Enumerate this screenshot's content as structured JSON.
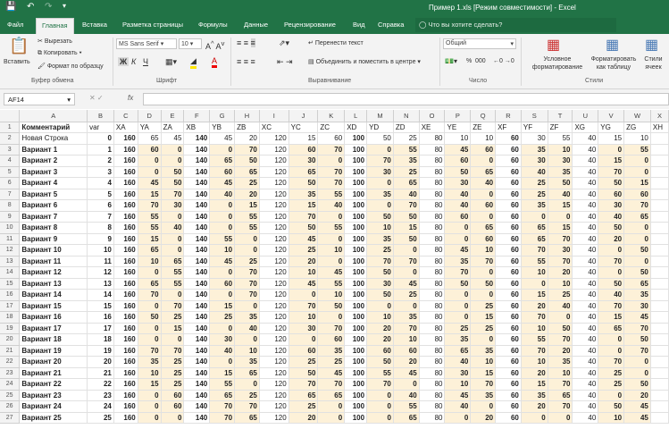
{
  "window": {
    "title": "Пример 1.xls [Режим совместимости] - Excel"
  },
  "tabs": [
    "Файл",
    "Главная",
    "Вставка",
    "Разметка страницы",
    "Формулы",
    "Данные",
    "Рецензирование",
    "Вид",
    "Справка"
  ],
  "search_placeholder": "Что вы хотите сделать?",
  "ribbon": {
    "paste": "Вставить",
    "cut": "Вырезать",
    "copy": "Копировать",
    "format_painter": "Формат по образцу",
    "clipboard_group": "Буфер обмена",
    "font_name": "MS Sans Serif",
    "font_size": "10",
    "bold": "Ж",
    "italic": "К",
    "underline": "Ч",
    "font_group": "Шрифт",
    "wrap_text": "Перенести текст",
    "merge_center": "Объединить и поместить в центре",
    "alignment_group": "Выравнивание",
    "number_format": "Общий",
    "percent": "%",
    "thousands": "000",
    "number_group": "Число",
    "cond_format": "Условное форматирование",
    "format_table": "Форматировать как таблицу",
    "cell_styles": "Стили ячеек",
    "styles_group": "Стили"
  },
  "formula_bar": {
    "name_box": "AF14",
    "fx": "fx",
    "value": ""
  },
  "grid": {
    "columns": [
      "A",
      "B",
      "C",
      "D",
      "E",
      "F",
      "G",
      "H",
      "I",
      "J",
      "K",
      "L",
      "M",
      "N",
      "O",
      "P",
      "Q",
      "R",
      "S",
      "T",
      "U",
      "V",
      "W",
      "X"
    ],
    "header_row": [
      "Комментарий",
      "var",
      "XA",
      "YA",
      "ZA",
      "XB",
      "YB",
      "ZB",
      "XC",
      "YC",
      "ZC",
      "XD",
      "YD",
      "ZD",
      "XE",
      "YE",
      "ZE",
      "XF",
      "YF",
      "ZF",
      "XG",
      "YG",
      "ZG",
      "XH"
    ],
    "rows": [
      [
        "Новая Строка",
        0,
        160,
        65,
        45,
        140,
        45,
        20,
        120,
        15,
        60,
        100,
        50,
        25,
        80,
        10,
        10,
        60,
        30,
        55,
        40,
        15,
        10
      ],
      [
        "Вариант 1",
        1,
        160,
        60,
        0,
        140,
        0,
        70,
        120,
        60,
        70,
        100,
        0,
        55,
        80,
        45,
        60,
        60,
        35,
        10,
        40,
        0,
        55
      ],
      [
        "Вариант 2",
        2,
        160,
        0,
        0,
        140,
        65,
        50,
        120,
        30,
        0,
        100,
        70,
        35,
        80,
        60,
        0,
        60,
        30,
        30,
        40,
        15,
        0
      ],
      [
        "Вариант 3",
        3,
        160,
        0,
        50,
        140,
        60,
        65,
        120,
        65,
        70,
        100,
        30,
        25,
        80,
        50,
        65,
        60,
        40,
        35,
        40,
        70,
        0
      ],
      [
        "Вариант 4",
        4,
        160,
        45,
        50,
        140,
        45,
        25,
        120,
        50,
        70,
        100,
        0,
        65,
        80,
        30,
        40,
        60,
        25,
        50,
        40,
        50,
        15
      ],
      [
        "Вариант 5",
        5,
        160,
        15,
        70,
        140,
        40,
        20,
        120,
        35,
        55,
        100,
        35,
        40,
        80,
        40,
        0,
        60,
        25,
        40,
        40,
        60,
        60
      ],
      [
        "Вариант 6",
        6,
        160,
        70,
        30,
        140,
        0,
        15,
        120,
        15,
        40,
        100,
        0,
        70,
        80,
        40,
        60,
        60,
        35,
        15,
        40,
        30,
        70
      ],
      [
        "Вариант 7",
        7,
        160,
        55,
        0,
        140,
        0,
        55,
        120,
        70,
        0,
        100,
        50,
        50,
        80,
        60,
        0,
        60,
        0,
        0,
        40,
        40,
        65
      ],
      [
        "Вариант 8",
        8,
        160,
        55,
        40,
        140,
        0,
        55,
        120,
        50,
        55,
        100,
        10,
        15,
        80,
        0,
        65,
        60,
        65,
        15,
        40,
        50,
        0
      ],
      [
        "Вариант 9",
        9,
        160,
        15,
        0,
        140,
        55,
        0,
        120,
        45,
        0,
        100,
        35,
        50,
        80,
        0,
        60,
        60,
        65,
        70,
        40,
        20,
        0
      ],
      [
        "Вариант 10",
        10,
        160,
        65,
        0,
        140,
        10,
        0,
        120,
        25,
        10,
        100,
        25,
        0,
        80,
        45,
        10,
        60,
        70,
        30,
        40,
        0,
        50
      ],
      [
        "Вариант 11",
        11,
        160,
        10,
        65,
        140,
        45,
        25,
        120,
        20,
        0,
        100,
        70,
        70,
        80,
        35,
        70,
        60,
        55,
        70,
        40,
        70,
        0
      ],
      [
        "Вариант 12",
        12,
        160,
        0,
        55,
        140,
        0,
        70,
        120,
        10,
        45,
        100,
        50,
        0,
        80,
        70,
        0,
        60,
        10,
        20,
        40,
        0,
        50
      ],
      [
        "Вариант 13",
        13,
        160,
        65,
        55,
        140,
        60,
        70,
        120,
        45,
        55,
        100,
        30,
        45,
        80,
        50,
        50,
        60,
        0,
        10,
        40,
        50,
        65
      ],
      [
        "Вариант 14",
        14,
        160,
        70,
        0,
        140,
        0,
        70,
        120,
        0,
        10,
        100,
        50,
        25,
        80,
        0,
        0,
        60,
        15,
        25,
        40,
        40,
        35
      ],
      [
        "Вариант 15",
        15,
        160,
        0,
        70,
        140,
        15,
        0,
        120,
        70,
        50,
        100,
        0,
        0,
        80,
        0,
        25,
        60,
        20,
        40,
        40,
        70,
        30
      ],
      [
        "Вариант 16",
        16,
        160,
        50,
        25,
        140,
        25,
        35,
        120,
        10,
        0,
        100,
        10,
        35,
        80,
        0,
        15,
        60,
        70,
        0,
        40,
        15,
        45
      ],
      [
        "Вариант 17",
        17,
        160,
        0,
        15,
        140,
        0,
        40,
        120,
        30,
        70,
        100,
        20,
        70,
        80,
        25,
        25,
        60,
        10,
        50,
        40,
        65,
        70
      ],
      [
        "Вариант 18",
        18,
        160,
        0,
        0,
        140,
        30,
        0,
        120,
        0,
        60,
        100,
        20,
        10,
        80,
        35,
        0,
        60,
        55,
        70,
        40,
        0,
        50
      ],
      [
        "Вариант 19",
        19,
        160,
        70,
        70,
        140,
        40,
        10,
        120,
        60,
        35,
        100,
        60,
        60,
        80,
        65,
        35,
        60,
        70,
        20,
        40,
        0,
        70
      ],
      [
        "Вариант 20",
        20,
        160,
        35,
        25,
        140,
        0,
        35,
        120,
        25,
        25,
        100,
        50,
        20,
        80,
        40,
        10,
        60,
        10,
        35,
        40,
        70,
        0
      ],
      [
        "Вариант 21",
        21,
        160,
        10,
        25,
        140,
        15,
        65,
        120,
        50,
        45,
        100,
        55,
        45,
        80,
        30,
        15,
        60,
        20,
        10,
        40,
        25,
        0
      ],
      [
        "Вариант 22",
        22,
        160,
        15,
        25,
        140,
        55,
        0,
        120,
        70,
        70,
        100,
        70,
        0,
        80,
        10,
        70,
        60,
        15,
        70,
        40,
        25,
        50
      ],
      [
        "Вариант 23",
        23,
        160,
        0,
        60,
        140,
        65,
        25,
        120,
        65,
        65,
        100,
        0,
        40,
        80,
        45,
        35,
        60,
        35,
        65,
        40,
        0,
        20
      ],
      [
        "Вариант 24",
        24,
        160,
        0,
        60,
        140,
        70,
        70,
        120,
        25,
        0,
        100,
        0,
        55,
        80,
        40,
        0,
        60,
        20,
        70,
        40,
        50,
        45
      ],
      [
        "Вариант 25",
        25,
        160,
        0,
        0,
        140,
        70,
        65,
        120,
        20,
        0,
        100,
        0,
        65,
        80,
        0,
        20,
        60,
        0,
        0,
        40,
        10,
        45
      ]
    ]
  },
  "colors": {
    "brand": "#217346",
    "shade": "#fdf1d8"
  }
}
